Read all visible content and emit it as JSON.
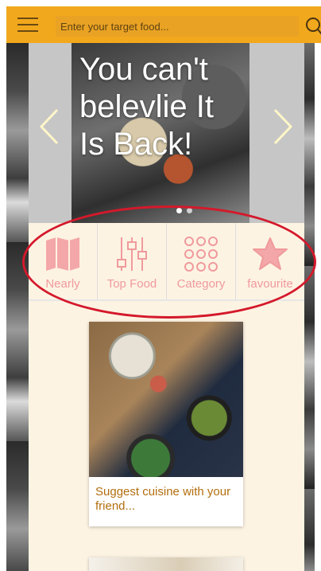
{
  "search": {
    "placeholder": "Enter your target food..."
  },
  "carousel": {
    "headline": "You can't belevlie It Is Back!",
    "slide_count": 2,
    "active_index": 0
  },
  "categories": [
    {
      "label": "Nearly",
      "icon": "map-icon"
    },
    {
      "label": "Top Food",
      "icon": "sliders-icon"
    },
    {
      "label": "Category",
      "icon": "grid-dots-icon"
    },
    {
      "label": "favourite",
      "icon": "star-icon"
    }
  ],
  "feed": [
    {
      "caption": "Suggest cuisine with your friend..."
    }
  ],
  "colors": {
    "header": "#f2a81d",
    "category_icon": "#f09a9c",
    "caption_text": "#b36e0e",
    "annotation": "#d4192b"
  }
}
